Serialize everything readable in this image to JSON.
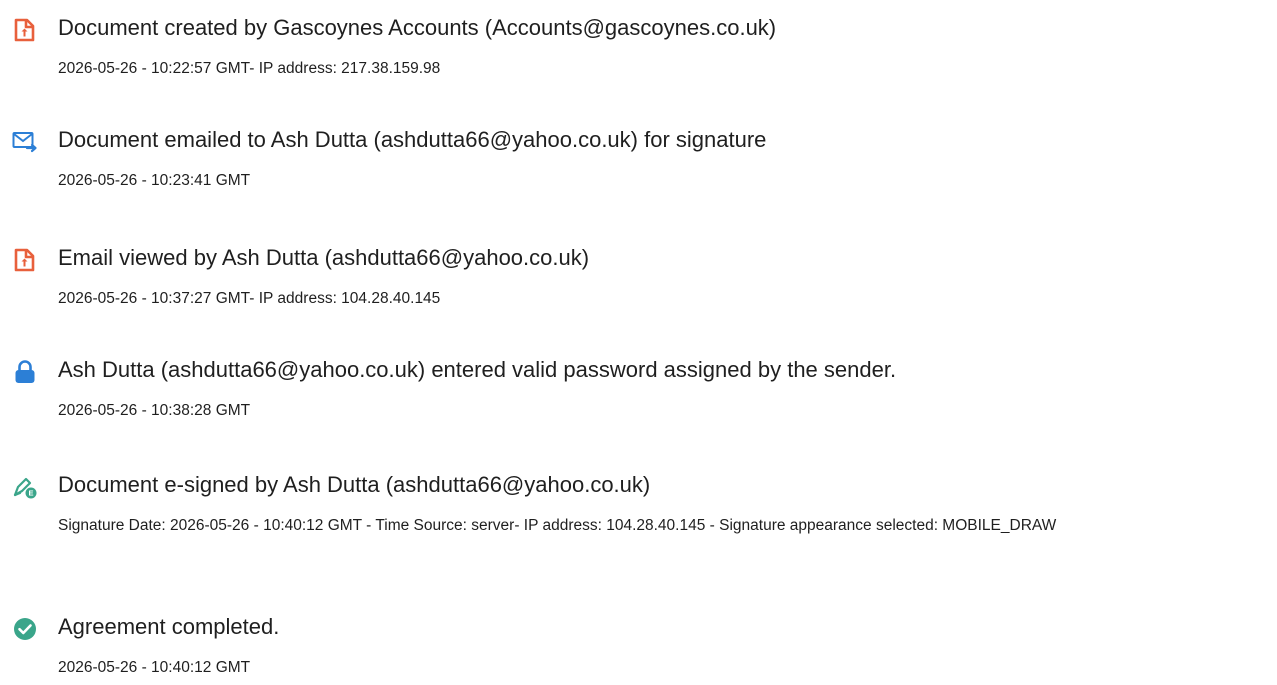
{
  "events": [
    {
      "icon": "document-created-icon",
      "title": "Document created by Gascoynes Accounts (Accounts@gascoynes.co.uk)",
      "detail": "2026-05-26 - 10:22:57 GMT- IP address: 217.38.159.98"
    },
    {
      "icon": "email-sent-icon",
      "title": "Document emailed to Ash Dutta (ashdutta66@yahoo.co.uk) for signature",
      "detail": "2026-05-26 - 10:23:41 GMT"
    },
    {
      "icon": "document-viewed-icon",
      "title": "Email viewed by Ash Dutta (ashdutta66@yahoo.co.uk)",
      "detail": "2026-05-26 - 10:37:27 GMT- IP address: 104.28.40.145"
    },
    {
      "icon": "lock-icon",
      "title": "Ash Dutta (ashdutta66@yahoo.co.uk) entered valid password assigned by the sender.",
      "detail": "2026-05-26 - 10:38:28 GMT"
    },
    {
      "icon": "e-signature-icon",
      "title": "Document e-signed by Ash Dutta (ashdutta66@yahoo.co.uk)",
      "detail": "Signature Date: 2026-05-26 - 10:40:12 GMT - Time Source: server- IP address: 104.28.40.145 - Signature appearance selected: MOBILE_DRAW"
    },
    {
      "icon": "check-circle-icon",
      "title": "Agreement completed.",
      "detail": "2026-05-26 - 10:40:12 GMT"
    }
  ],
  "colors": {
    "document_icon": "#e8603c",
    "email_icon": "#2c7fd6",
    "lock_icon": "#2c7fd6",
    "signature_icon": "#3aa58a",
    "check_icon": "#3aa58a",
    "text": "#1f1f1f"
  }
}
